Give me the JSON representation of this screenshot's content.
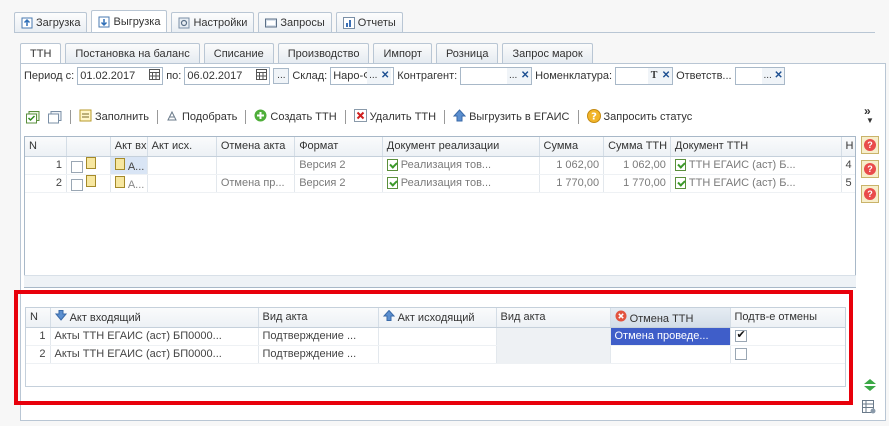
{
  "main_tabs": [
    {
      "label": "Загрузка",
      "icon": "upload-icon"
    },
    {
      "label": "Выгрузка",
      "icon": "download-icon",
      "active": true
    },
    {
      "label": "Настройки",
      "icon": "settings-icon"
    },
    {
      "label": "Запросы",
      "icon": "requests-icon"
    },
    {
      "label": "Отчеты",
      "icon": "reports-icon"
    }
  ],
  "sub_tabs": [
    "ТТН",
    "Постановка на баланс",
    "Списание",
    "Производство",
    "Импорт",
    "Розница",
    "Запрос марок"
  ],
  "filter": {
    "period_label": "Период с:",
    "date_from": "01.02.2017",
    "to_label": "по:",
    "date_to": "06.02.2017",
    "more_btn": "...",
    "warehouse_label": "Склад:",
    "warehouse_value": "Наро-Ф",
    "counterparty_label": "Контрагент:",
    "counterparty_value": "",
    "nomenclature_label": "Номенклатура:",
    "nomenclature_value": "",
    "t_btn": "T",
    "responsible_label": "Ответств...",
    "responsible_value": ""
  },
  "toolbar": {
    "fill": "Заполнить",
    "pick": "Подобрать",
    "create": "Создать ТТН",
    "delete": "Удалить ТТН",
    "upload": "Выгрузить в ЕГАИС",
    "status": "Запросить статус",
    "more": "»"
  },
  "grid1": {
    "headers": [
      "N",
      "",
      "Акт вх.",
      "Акт исх.",
      "Отмена акта",
      "Формат",
      "Документ реализации",
      "Сумма",
      "Сумма ТТН",
      "Документ ТТН",
      "Н"
    ],
    "rows": [
      {
        "n": "1",
        "act_in": "А...",
        "act_out": "",
        "cancel": "",
        "format": "Версия 2",
        "doc": "Реализация тов...",
        "sum": "1 062,00",
        "sum_ttn": "1 062,00",
        "ttn": "ТТН ЕГАИС (аст) Б...",
        "h": "4"
      },
      {
        "n": "2",
        "act_in": "А...",
        "act_out": "",
        "cancel": "Отмена пр...",
        "format": "Версия 2",
        "doc": "Реализация тов...",
        "sum": "1 770,00",
        "sum_ttn": "1 770,00",
        "ttn": "ТТН ЕГАИС (аст) Б...",
        "h": "5"
      }
    ]
  },
  "grid2": {
    "headers": [
      "N",
      "Акт входящий",
      "Вид акта",
      "Акт исходящий",
      "Вид акта",
      "Отмена ТТН",
      "Подтв-е отмены"
    ],
    "rows": [
      {
        "n": "1",
        "act_in": "Акты ТТН ЕГАИС (аст) БП0000...",
        "kind": "Подтверждение ...",
        "act_out": "",
        "kind2": "",
        "cancel": "Отмена проведе...",
        "confirmed": true
      },
      {
        "n": "2",
        "act_in": "Акты ТТН ЕГАИС (аст) БП0000...",
        "kind": "Подтверждение ...",
        "act_out": "",
        "kind2": "",
        "cancel": "",
        "confirmed": false
      }
    ]
  },
  "colors": {
    "highlight_border": "#e8000b",
    "selected_cell": "#3f5ec9"
  }
}
